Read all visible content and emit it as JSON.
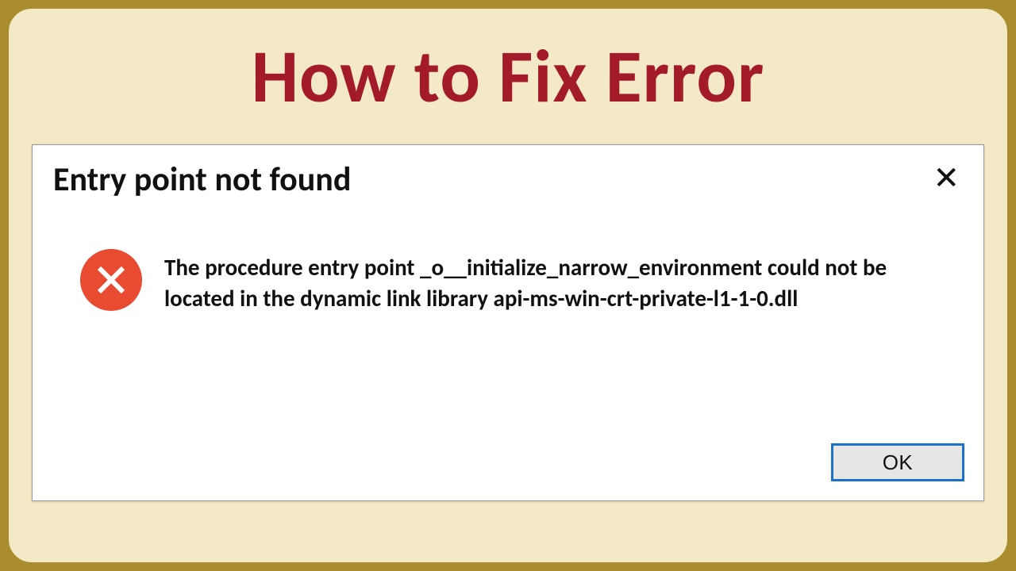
{
  "page": {
    "title": "How to Fix Error"
  },
  "dialog": {
    "title": "Entry point not found",
    "message": "The procedure entry point _o__initialize_narrow_environment could not be located in the dynamic link library api-ms-win-crt-private-l1-1-0.dll",
    "ok_label": "OK",
    "icon": "error-cross-icon",
    "close_glyph": "✕"
  },
  "colors": {
    "accent_frame": "#a88c2e",
    "panel_bg": "#f3e9c6",
    "title_color": "#a31a2a",
    "error_icon": "#e84b2f",
    "ok_border": "#1a73c8"
  }
}
